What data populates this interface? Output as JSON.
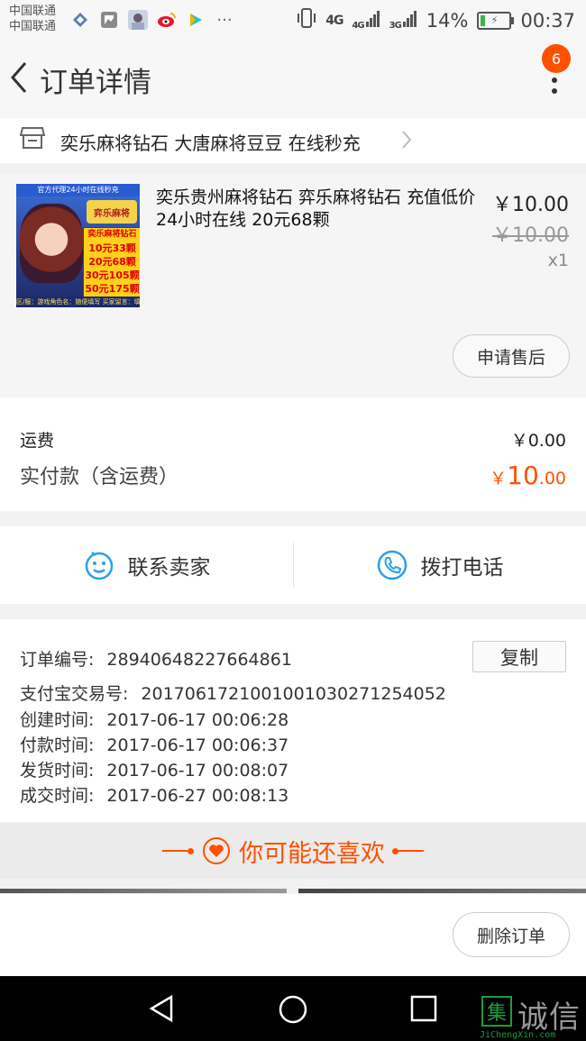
{
  "status_bar": {
    "carrier_1": "中国联通",
    "carrier_2": "中国联通",
    "network_1": "4G",
    "network_2": "4G",
    "network_3": "3G",
    "battery": "14%",
    "time": "00:37",
    "notification_icons": [
      "tuiyou-icon",
      "gallery-icon",
      "avatar-icon",
      "weibo-icon",
      "video-icon",
      "more-dots-icon"
    ]
  },
  "header": {
    "title": "订单详情",
    "badge_count": "6"
  },
  "shop": {
    "name": "奕乐麻将钻石 大唐麻将豆豆 在线秒充"
  },
  "item": {
    "title": "奕乐贵州麻将钻石 弈乐麻将钻石 充值低价 24小时在线 20元68颗",
    "price": "￥10.00",
    "original_price": "￥10.00",
    "quantity": "x1",
    "aftersale_label": "申请售后",
    "thumbnail": {
      "banner": "官方代理24小时在线秒充",
      "logo": "弈乐麻将",
      "lines": [
        "奕乐麻将钻石",
        "10元33颗",
        "20元68颗",
        "30元105颗",
        "50元175颗"
      ],
      "footer": "区/服：游戏角色名：随便填写 买家留言：填上"
    }
  },
  "payment": {
    "shipping_label": "运费",
    "shipping_value": "￥0.00",
    "paid_label": "实付款（含运费）",
    "paid_currency": "￥",
    "paid_integer": "10",
    "paid_decimal": ".00",
    "accent_color": "#ff5000"
  },
  "contact": {
    "seller_label": "联系卖家",
    "phone_label": "拨打电话",
    "icon_color": "#29a1e6"
  },
  "order_info": {
    "copy_label": "复制",
    "rows": [
      {
        "label": "订单编号:",
        "value": "28940648227664861"
      },
      {
        "label": "支付宝交易号:",
        "value": "2017061721001001030271254052"
      },
      {
        "label": "创建时间:",
        "value": "2017-06-17 00:06:28"
      },
      {
        "label": "付款时间:",
        "value": "2017-06-17 00:06:37"
      },
      {
        "label": "发货时间:",
        "value": "2017-06-17 00:08:07"
      },
      {
        "label": "成交时间:",
        "value": "2017-06-27 00:08:13"
      }
    ]
  },
  "recommend": {
    "title": "你可能还喜欢"
  },
  "footer": {
    "delete_label": "删除订单"
  },
  "watermark": {
    "logo_char": "集",
    "text": "诚信",
    "url": "JiChengXin.com"
  }
}
